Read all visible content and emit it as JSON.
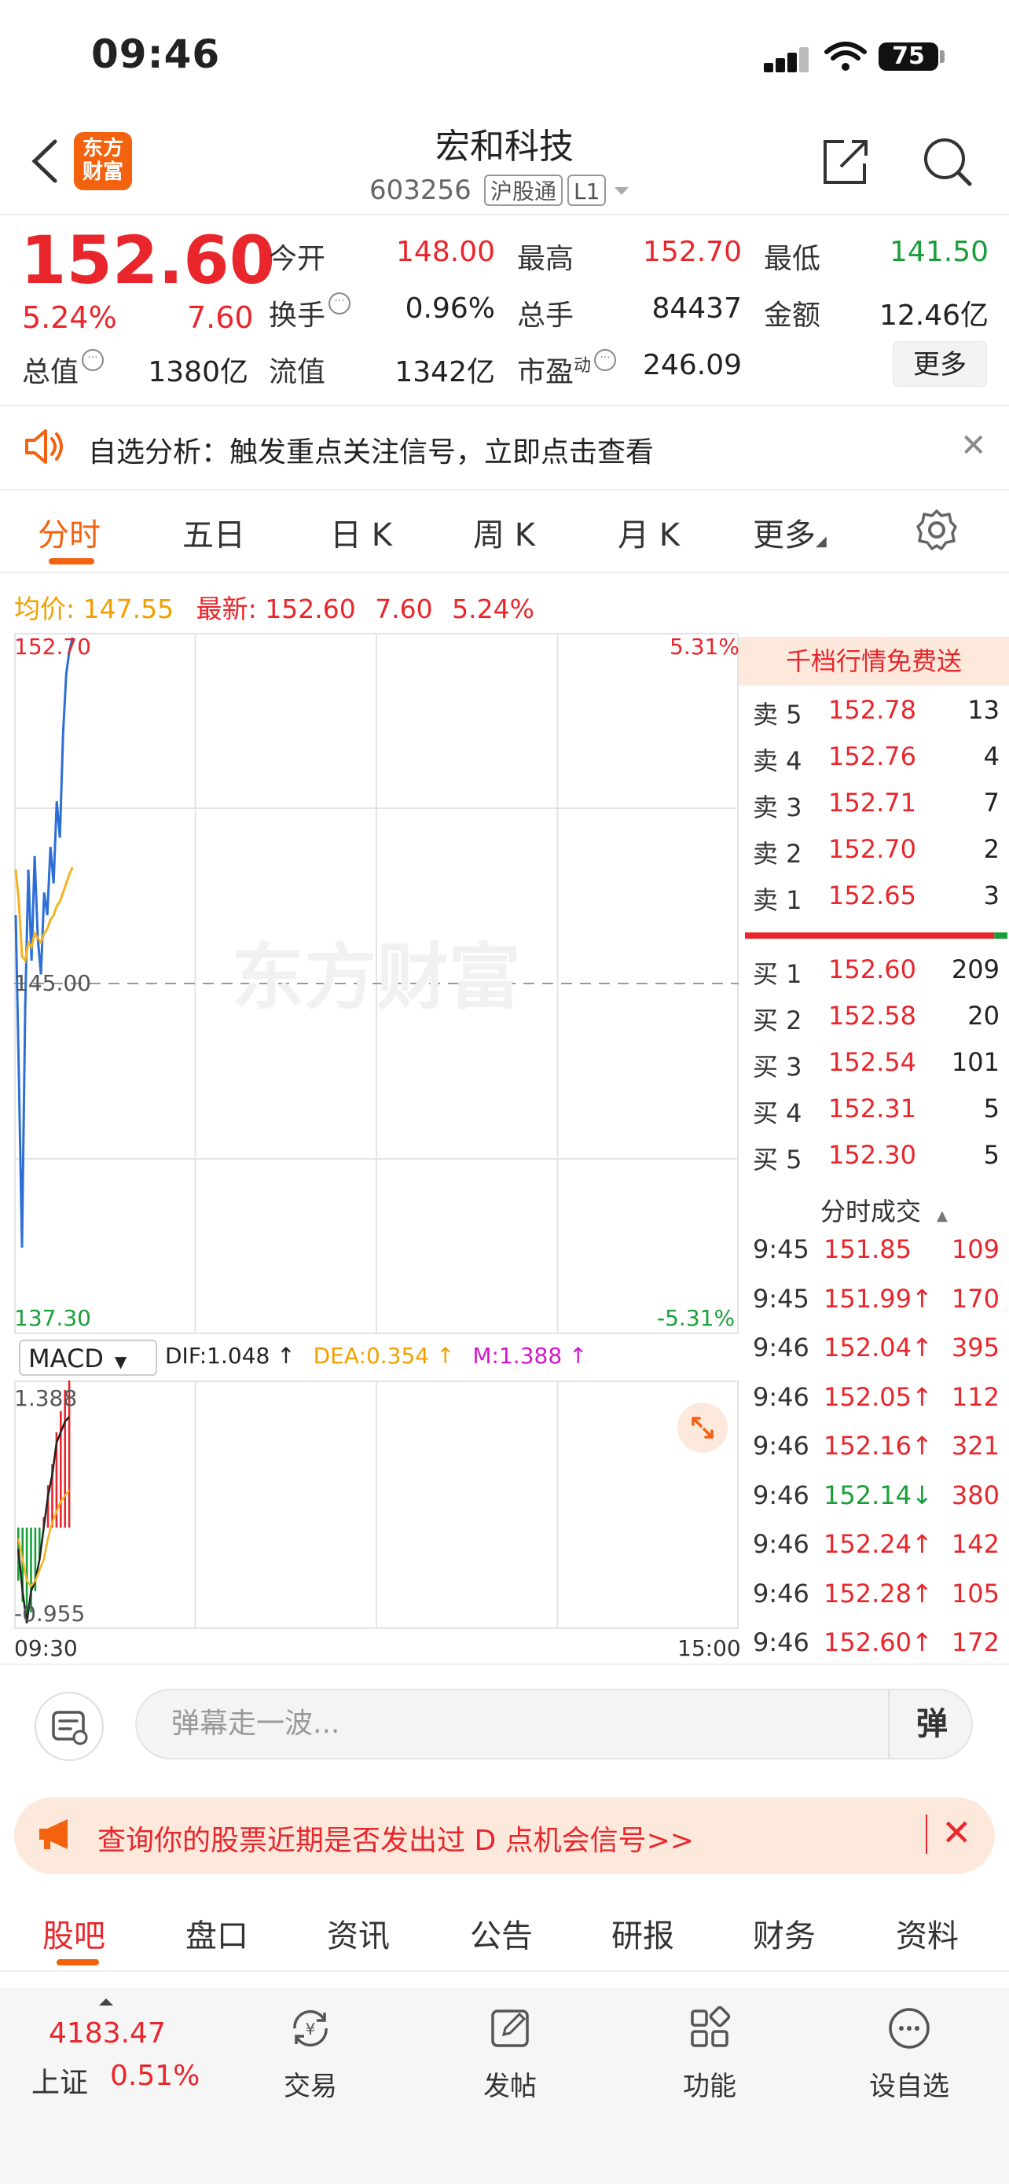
{
  "status_bar": {
    "time": "09:46",
    "battery": "75"
  },
  "header": {
    "logo_line1": "东方",
    "logo_line2": "财富",
    "stock_name": "宏和科技",
    "stock_code": "603256",
    "tag_connect": "沪股通",
    "tag_level": "L1"
  },
  "quote": {
    "price": "152.60",
    "change_pct": "5.24%",
    "change": "7.60",
    "open_label": "今开",
    "open": "148.00",
    "high_label": "最高",
    "high": "152.70",
    "low_label": "最低",
    "low": "141.50",
    "turnover_label": "换手",
    "turnover": "0.96%",
    "volume_label": "总手",
    "volume": "84437",
    "amount_label": "金额",
    "amount": "12.46亿",
    "mcap_label": "总值",
    "mcap": "1380亿",
    "float_label": "流值",
    "float": "1342亿",
    "pe_label": "市盈",
    "pe_sup": "动",
    "pe": "246.09",
    "more_label": "更多"
  },
  "alert": {
    "text": "自选分析：触发重点关注信号，立即点击查看"
  },
  "chart_tabs": [
    "分时",
    "五日",
    "日 K",
    "周 K",
    "月 K",
    "更多"
  ],
  "avg_row": {
    "avg_label": "均价:",
    "avg": "147.55",
    "last_label": "最新:",
    "last": "152.60",
    "change": "7.60",
    "pct": "5.24%"
  },
  "chart_data": {
    "type": "line",
    "title": "",
    "ylim": [
      137.3,
      152.7
    ],
    "y_left_ticks": [
      "152.70",
      "145.00",
      "137.30"
    ],
    "y_right_ticks": [
      "5.31%",
      "-5.31%"
    ],
    "x_labels": [
      "09:30",
      "15:00"
    ],
    "watermark": "东方财富",
    "colors": {
      "price": "#2d6fd6",
      "avg": "#f5b323"
    },
    "series": [
      {
        "values": [
          146.5,
          143.0,
          139.2,
          144.5,
          147.5,
          145.5,
          147.8,
          146.0,
          145.2,
          147.0,
          146.5,
          148.0,
          147.2,
          149.0,
          148.2,
          150.5,
          151.8,
          152.3,
          152.6
        ]
      },
      {
        "values": [
          147.5,
          146.8,
          145.6,
          145.5,
          145.9,
          145.8,
          146.1,
          146.0,
          145.9,
          146.1,
          146.2,
          146.4,
          146.5,
          146.7,
          146.8,
          147.0,
          147.2,
          147.4,
          147.55
        ]
      }
    ]
  },
  "macd": {
    "selector": "MACD",
    "dif": "DIF:1.048 ↑",
    "dea": "DEA:0.354 ↑",
    "m": "M:1.388 ↑",
    "top": "1.388",
    "bottom": "-0.955",
    "bars": [
      -0.5,
      -0.7,
      -0.9,
      -0.8,
      -0.6,
      -0.3,
      0.1,
      0.4,
      0.6,
      0.9,
      1.1,
      1.3,
      1.388
    ],
    "dif_line": [
      -0.2,
      -0.6,
      -0.9,
      -0.6,
      -0.5,
      -0.3,
      0.0,
      0.3,
      0.5,
      0.8,
      0.9,
      1.0,
      1.048
    ],
    "dea_line": [
      -0.1,
      -0.3,
      -0.5,
      -0.55,
      -0.5,
      -0.4,
      -0.3,
      -0.1,
      0.05,
      0.15,
      0.25,
      0.3,
      0.354
    ]
  },
  "order_book": {
    "title": "千档行情免费送",
    "asks": [
      {
        "label": "卖 5",
        "price": "152.78",
        "vol": "13"
      },
      {
        "label": "卖 4",
        "price": "152.76",
        "vol": "4"
      },
      {
        "label": "卖 3",
        "price": "152.71",
        "vol": "7"
      },
      {
        "label": "卖 2",
        "price": "152.70",
        "vol": "2"
      },
      {
        "label": "卖 1",
        "price": "152.65",
        "vol": "3"
      }
    ],
    "bids": [
      {
        "label": "买 1",
        "price": "152.60",
        "vol": "209"
      },
      {
        "label": "买 2",
        "price": "152.58",
        "vol": "20"
      },
      {
        "label": "买 3",
        "price": "152.54",
        "vol": "101"
      },
      {
        "label": "买 4",
        "price": "152.31",
        "vol": "5"
      },
      {
        "label": "买 5",
        "price": "152.30",
        "vol": "5"
      }
    ],
    "buy_ratio": 0.95
  },
  "ticks": {
    "title": "分时成交",
    "rows": [
      {
        "time": "9:45",
        "price": "151.85",
        "arrow": "",
        "vol": "109",
        "dir": "up"
      },
      {
        "time": "9:45",
        "price": "151.99↑",
        "arrow": "",
        "vol": "170",
        "dir": "up"
      },
      {
        "time": "9:46",
        "price": "152.04↑",
        "arrow": "",
        "vol": "395",
        "dir": "up"
      },
      {
        "time": "9:46",
        "price": "152.05↑",
        "arrow": "",
        "vol": "112",
        "dir": "up"
      },
      {
        "time": "9:46",
        "price": "152.16↑",
        "arrow": "",
        "vol": "321",
        "dir": "up"
      },
      {
        "time": "9:46",
        "price": "152.14↓",
        "arrow": "",
        "vol": "380",
        "dir": "down"
      },
      {
        "time": "9:46",
        "price": "152.24↑",
        "arrow": "",
        "vol": "142",
        "dir": "up"
      },
      {
        "time": "9:46",
        "price": "152.28↑",
        "arrow": "",
        "vol": "105",
        "dir": "up"
      },
      {
        "time": "9:46",
        "price": "152.60↑",
        "arrow": "",
        "vol": "172",
        "dir": "up"
      }
    ]
  },
  "danmaku": {
    "placeholder": "弹幕走一波...",
    "button": "弹"
  },
  "promo": {
    "text": "查询你的股票近期是否发出过 D 点机会信号>>"
  },
  "bottom_tabs": [
    "股吧",
    "盘口",
    "资讯",
    "公告",
    "研报",
    "财务",
    "资料"
  ],
  "index": {
    "value": "4183.47",
    "name": "上证",
    "pct": "0.51%"
  },
  "nav": [
    {
      "label": "交易",
      "icon": "trade-icon"
    },
    {
      "label": "发帖",
      "icon": "post-icon"
    },
    {
      "label": "功能",
      "icon": "grid-icon"
    },
    {
      "label": "设自选",
      "icon": "more-icon"
    }
  ]
}
